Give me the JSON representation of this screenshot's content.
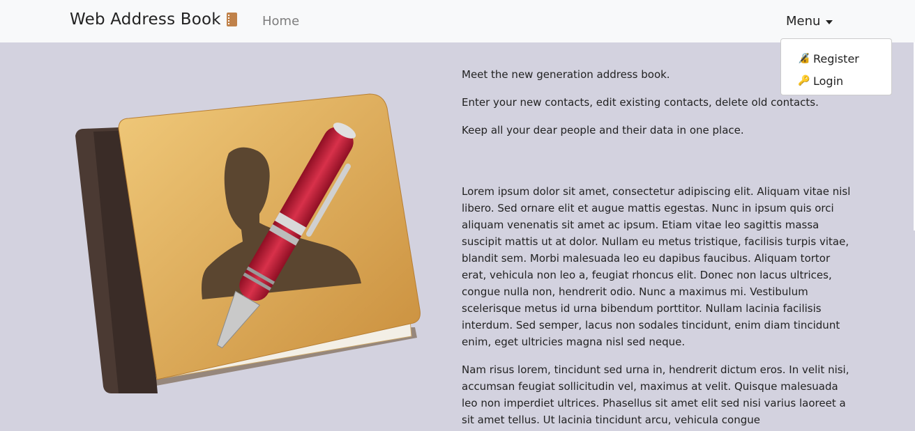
{
  "navbar": {
    "brand": "Web Address Book",
    "brand_icon": "address-book-icon",
    "home_label": "Home",
    "menu_label": "Menu"
  },
  "dropdown": {
    "items": [
      {
        "label": "Register",
        "icon": "lock-key-icon"
      },
      {
        "label": "Login",
        "icon": "key-icon"
      }
    ]
  },
  "intro": {
    "line1": "Meet the new generation address book.",
    "line2": "Enter your new contacts, edit existing contacts, delete old contacts.",
    "line3": "Keep all your dear people and their data in one place."
  },
  "body": {
    "para1": "Lorem ipsum dolor sit amet, consectetur adipiscing elit. Aliquam vitae nisl libero. Sed ornare elit et augue mattis egestas. Nunc in ipsum quis orci aliquam venenatis sit amet ac ipsum. Etiam vitae leo sagittis massa suscipit mattis ut at dolor. Nullam eu metus tristique, facilisis turpis vitae, blandit sem. Morbi malesuada leo eu dapibus faucibus. Aliquam tortor erat, vehicula non leo a, feugiat rhoncus elit. Donec non lacus ultrices, congue nulla non, hendrerit odio. Nunc a maximus mi. Vestibulum scelerisque metus id urna bibendum porttitor. Nullam lacinia facilisis interdum. Sed semper, lacus non sodales tincidunt, enim diam tincidunt enim, eget ultricies magna nisl sed neque.",
    "para2": "Nam risus lorem, tincidunt sed urna in, hendrerit dictum eros. In velit nisi, accumsan feugiat sollicitudin vel, maximus at velit. Quisque malesuada leo non imperdiet ultrices. Phasellus sit amet elit sed nisi varius laoreet a sit amet tellus. Ut lacinia tincidunt arcu, vehicula congue"
  },
  "colors": {
    "background": "#d3d2df",
    "navbar": "#f8f9fa",
    "book_cover": "#d9a14f",
    "book_spine": "#4a3a32",
    "pen": "#c8213a"
  }
}
